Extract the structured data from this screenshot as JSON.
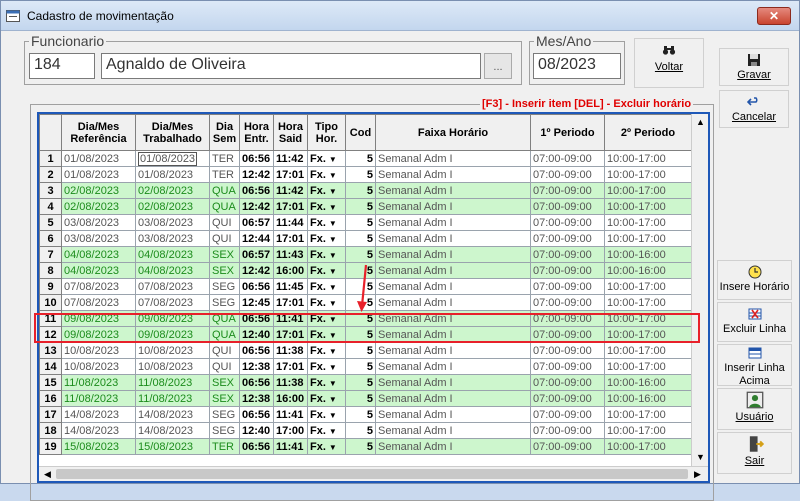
{
  "window": {
    "title": "Cadastro de movimentação",
    "close_label": "✕"
  },
  "funcionario": {
    "legend": "Funcionario",
    "code": "184",
    "name": "Agnaldo de Oliveira",
    "lookup_label": "..."
  },
  "mes_ano": {
    "legend": "Mes/Ano",
    "value": "08/2023"
  },
  "buttons": {
    "voltar": "Voltar",
    "gravar": "Gravar",
    "cancelar": "Cancelar",
    "insere_horario": "Insere Horário",
    "excluir_linha": "Excluir Linha",
    "inserir_linha_acima_1": "Inserir Linha",
    "inserir_linha_acima_2": "Acima",
    "usuario": "Usuário",
    "sair": "Sair"
  },
  "hint": "[F3] - Inserir item [DEL] - Excluir horário",
  "columns": {
    "ref_1": "Dia/Mes",
    "ref_2": "Referência",
    "trab_1": "Dia/Mes",
    "trab_2": "Trabalhado",
    "sem_1": "Dia",
    "sem_2": "Sem",
    "entr_1": "Hora",
    "entr_2": "Entr.",
    "said_1": "Hora",
    "said_2": "Said",
    "tipo_1": "Tipo",
    "tipo_2": "Hor.",
    "cod": "Cod",
    "faixa": "Faixa Horário",
    "p1": "1º Periodo",
    "p2": "2º Periodo"
  },
  "rows": [
    {
      "n": "1",
      "ref": "01/08/2023",
      "trab": "01/08/2023",
      "sem": "TER",
      "entr": "06:56",
      "said": "11:42",
      "tipo": "Fx.",
      "cod": "5",
      "faixa": "Semanal Adm I",
      "p1": "07:00-09:00",
      "p2": "10:00-17:00",
      "green": false
    },
    {
      "n": "2",
      "ref": "01/08/2023",
      "trab": "01/08/2023",
      "sem": "TER",
      "entr": "12:42",
      "said": "17:01",
      "tipo": "Fx.",
      "cod": "5",
      "faixa": "Semanal Adm I",
      "p1": "07:00-09:00",
      "p2": "10:00-17:00",
      "green": false
    },
    {
      "n": "3",
      "ref": "02/08/2023",
      "trab": "02/08/2023",
      "sem": "QUA",
      "entr": "06:56",
      "said": "11:42",
      "tipo": "Fx.",
      "cod": "5",
      "faixa": "Semanal Adm I",
      "p1": "07:00-09:00",
      "p2": "10:00-17:00",
      "green": true
    },
    {
      "n": "4",
      "ref": "02/08/2023",
      "trab": "02/08/2023",
      "sem": "QUA",
      "entr": "12:42",
      "said": "17:01",
      "tipo": "Fx.",
      "cod": "5",
      "faixa": "Semanal Adm I",
      "p1": "07:00-09:00",
      "p2": "10:00-17:00",
      "green": true
    },
    {
      "n": "5",
      "ref": "03/08/2023",
      "trab": "03/08/2023",
      "sem": "QUI",
      "entr": "06:57",
      "said": "11:44",
      "tipo": "Fx.",
      "cod": "5",
      "faixa": "Semanal Adm I",
      "p1": "07:00-09:00",
      "p2": "10:00-17:00",
      "green": false
    },
    {
      "n": "6",
      "ref": "03/08/2023",
      "trab": "03/08/2023",
      "sem": "QUI",
      "entr": "12:44",
      "said": "17:01",
      "tipo": "Fx.",
      "cod": "5",
      "faixa": "Semanal Adm I",
      "p1": "07:00-09:00",
      "p2": "10:00-17:00",
      "green": false
    },
    {
      "n": "7",
      "ref": "04/08/2023",
      "trab": "04/08/2023",
      "sem": "SEX",
      "entr": "06:57",
      "said": "11:43",
      "tipo": "Fx.",
      "cod": "5",
      "faixa": "Semanal Adm I",
      "p1": "07:00-09:00",
      "p2": "10:00-16:00",
      "green": true
    },
    {
      "n": "8",
      "ref": "04/08/2023",
      "trab": "04/08/2023",
      "sem": "SEX",
      "entr": "12:42",
      "said": "16:00",
      "tipo": "Fx.",
      "cod": "5",
      "faixa": "Semanal Adm I",
      "p1": "07:00-09:00",
      "p2": "10:00-16:00",
      "green": true
    },
    {
      "n": "9",
      "ref": "07/08/2023",
      "trab": "07/08/2023",
      "sem": "SEG",
      "entr": "06:56",
      "said": "11:45",
      "tipo": "Fx.",
      "cod": "5",
      "faixa": "Semanal Adm I",
      "p1": "07:00-09:00",
      "p2": "10:00-17:00",
      "green": false
    },
    {
      "n": "10",
      "ref": "07/08/2023",
      "trab": "07/08/2023",
      "sem": "SEG",
      "entr": "12:45",
      "said": "17:01",
      "tipo": "Fx.",
      "cod": "5",
      "faixa": "Semanal Adm I",
      "p1": "07:00-09:00",
      "p2": "10:00-17:00",
      "green": false
    },
    {
      "n": "11",
      "ref": "09/08/2023",
      "trab": "09/08/2023",
      "sem": "QUA",
      "entr": "06:56",
      "said": "11:41",
      "tipo": "Fx.",
      "cod": "5",
      "faixa": "Semanal Adm I",
      "p1": "07:00-09:00",
      "p2": "10:00-17:00",
      "green": true
    },
    {
      "n": "12",
      "ref": "09/08/2023",
      "trab": "09/08/2023",
      "sem": "QUA",
      "entr": "12:40",
      "said": "17:01",
      "tipo": "Fx.",
      "cod": "5",
      "faixa": "Semanal Adm I",
      "p1": "07:00-09:00",
      "p2": "10:00-17:00",
      "green": true
    },
    {
      "n": "13",
      "ref": "10/08/2023",
      "trab": "10/08/2023",
      "sem": "QUI",
      "entr": "06:56",
      "said": "11:38",
      "tipo": "Fx.",
      "cod": "5",
      "faixa": "Semanal Adm I",
      "p1": "07:00-09:00",
      "p2": "10:00-17:00",
      "green": false
    },
    {
      "n": "14",
      "ref": "10/08/2023",
      "trab": "10/08/2023",
      "sem": "QUI",
      "entr": "12:38",
      "said": "17:01",
      "tipo": "Fx.",
      "cod": "5",
      "faixa": "Semanal Adm I",
      "p1": "07:00-09:00",
      "p2": "10:00-17:00",
      "green": false
    },
    {
      "n": "15",
      "ref": "11/08/2023",
      "trab": "11/08/2023",
      "sem": "SEX",
      "entr": "06:56",
      "said": "11:38",
      "tipo": "Fx.",
      "cod": "5",
      "faixa": "Semanal Adm I",
      "p1": "07:00-09:00",
      "p2": "10:00-16:00",
      "green": true
    },
    {
      "n": "16",
      "ref": "11/08/2023",
      "trab": "11/08/2023",
      "sem": "SEX",
      "entr": "12:38",
      "said": "16:00",
      "tipo": "Fx.",
      "cod": "5",
      "faixa": "Semanal Adm I",
      "p1": "07:00-09:00",
      "p2": "10:00-16:00",
      "green": true
    },
    {
      "n": "17",
      "ref": "14/08/2023",
      "trab": "14/08/2023",
      "sem": "SEG",
      "entr": "06:56",
      "said": "11:41",
      "tipo": "Fx.",
      "cod": "5",
      "faixa": "Semanal Adm I",
      "p1": "07:00-09:00",
      "p2": "10:00-17:00",
      "green": false
    },
    {
      "n": "18",
      "ref": "14/08/2023",
      "trab": "14/08/2023",
      "sem": "SEG",
      "entr": "12:40",
      "said": "17:00",
      "tipo": "Fx.",
      "cod": "5",
      "faixa": "Semanal Adm I",
      "p1": "07:00-09:00",
      "p2": "10:00-17:00",
      "green": false
    },
    {
      "n": "19",
      "ref": "15/08/2023",
      "trab": "15/08/2023",
      "sem": "TER",
      "entr": "06:56",
      "said": "11:41",
      "tipo": "Fx.",
      "cod": "5",
      "faixa": "Semanal Adm I",
      "p1": "07:00-09:00",
      "p2": "10:00-17:00",
      "green": true
    }
  ],
  "colors": {
    "green_row": "#cdf6cd",
    "grid_border": "#1e58b8",
    "hint": "#e00000",
    "annotation": "#e8202a"
  }
}
